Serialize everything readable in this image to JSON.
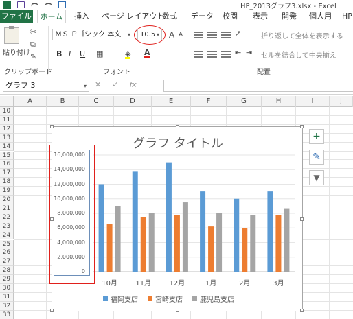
{
  "window": {
    "title": "HP_2013グラフ3.xlsx - Excel"
  },
  "tabs": [
    "ファイル",
    "ホーム",
    "挿入",
    "ページ レイアウト",
    "数式",
    "データ",
    "校閲",
    "表示",
    "開発",
    "個人用",
    "HP"
  ],
  "ribbon": {
    "paste_label": "貼り付け",
    "clipboard_label": "クリップボード",
    "font_label": "フォント",
    "align_label": "配置",
    "font_name": "ＭＳ Ｐゴシック 本文",
    "font_size": "10.5",
    "bold": "B",
    "italic": "I",
    "underline": "U",
    "grow": "A",
    "shrink": "A",
    "wrap_text": "折り返して全体を表示する",
    "merge_center": "セルを結合して中央揃え"
  },
  "formula_bar": {
    "name_box": "グラフ 3",
    "cancel": "✕",
    "enter": "✓",
    "fx": "fx",
    "value": ""
  },
  "columns": [
    "A",
    "B",
    "C",
    "D",
    "E",
    "F",
    "G",
    "H",
    "I",
    "J"
  ],
  "rows": [
    "10",
    "11",
    "12",
    "13",
    "14",
    "15",
    "16",
    "17",
    "18",
    "19",
    "20",
    "21",
    "22",
    "23",
    "24",
    "25",
    "26",
    "27",
    "28",
    "29",
    "30",
    "31",
    "32",
    "33"
  ],
  "colors": {
    "fukuoka": "#5B9BD5",
    "miyazaki": "#ED7D31",
    "kagoshima": "#A5A5A5",
    "selection_red": "#E0201C",
    "excel_green": "#217346"
  },
  "side_buttons": [
    "plus-icon",
    "brush-icon",
    "filter-icon"
  ],
  "chart_data": {
    "type": "bar",
    "title": "グラフ タイトル",
    "categories": [
      "10月",
      "11月",
      "12月",
      "1月",
      "2月",
      "3月"
    ],
    "series": [
      {
        "name": "福岡支店",
        "values": [
          12000000,
          13800000,
          15000000,
          11000000,
          10000000,
          11000000
        ]
      },
      {
        "name": "宮崎支店",
        "values": [
          6500000,
          7500000,
          7800000,
          6200000,
          6000000,
          7800000
        ]
      },
      {
        "name": "鹿児島支店",
        "values": [
          9000000,
          8000000,
          9500000,
          8000000,
          7800000,
          8700000
        ]
      }
    ],
    "ylim": [
      0,
      16000000
    ],
    "yticks": [
      "16,000,000",
      "14,000,000",
      "12,000,000",
      "10,000,000",
      "8,000,000",
      "6,000,000",
      "4,000,000",
      "2,000,000",
      "0"
    ],
    "legend": "bottom",
    "grid": true
  }
}
